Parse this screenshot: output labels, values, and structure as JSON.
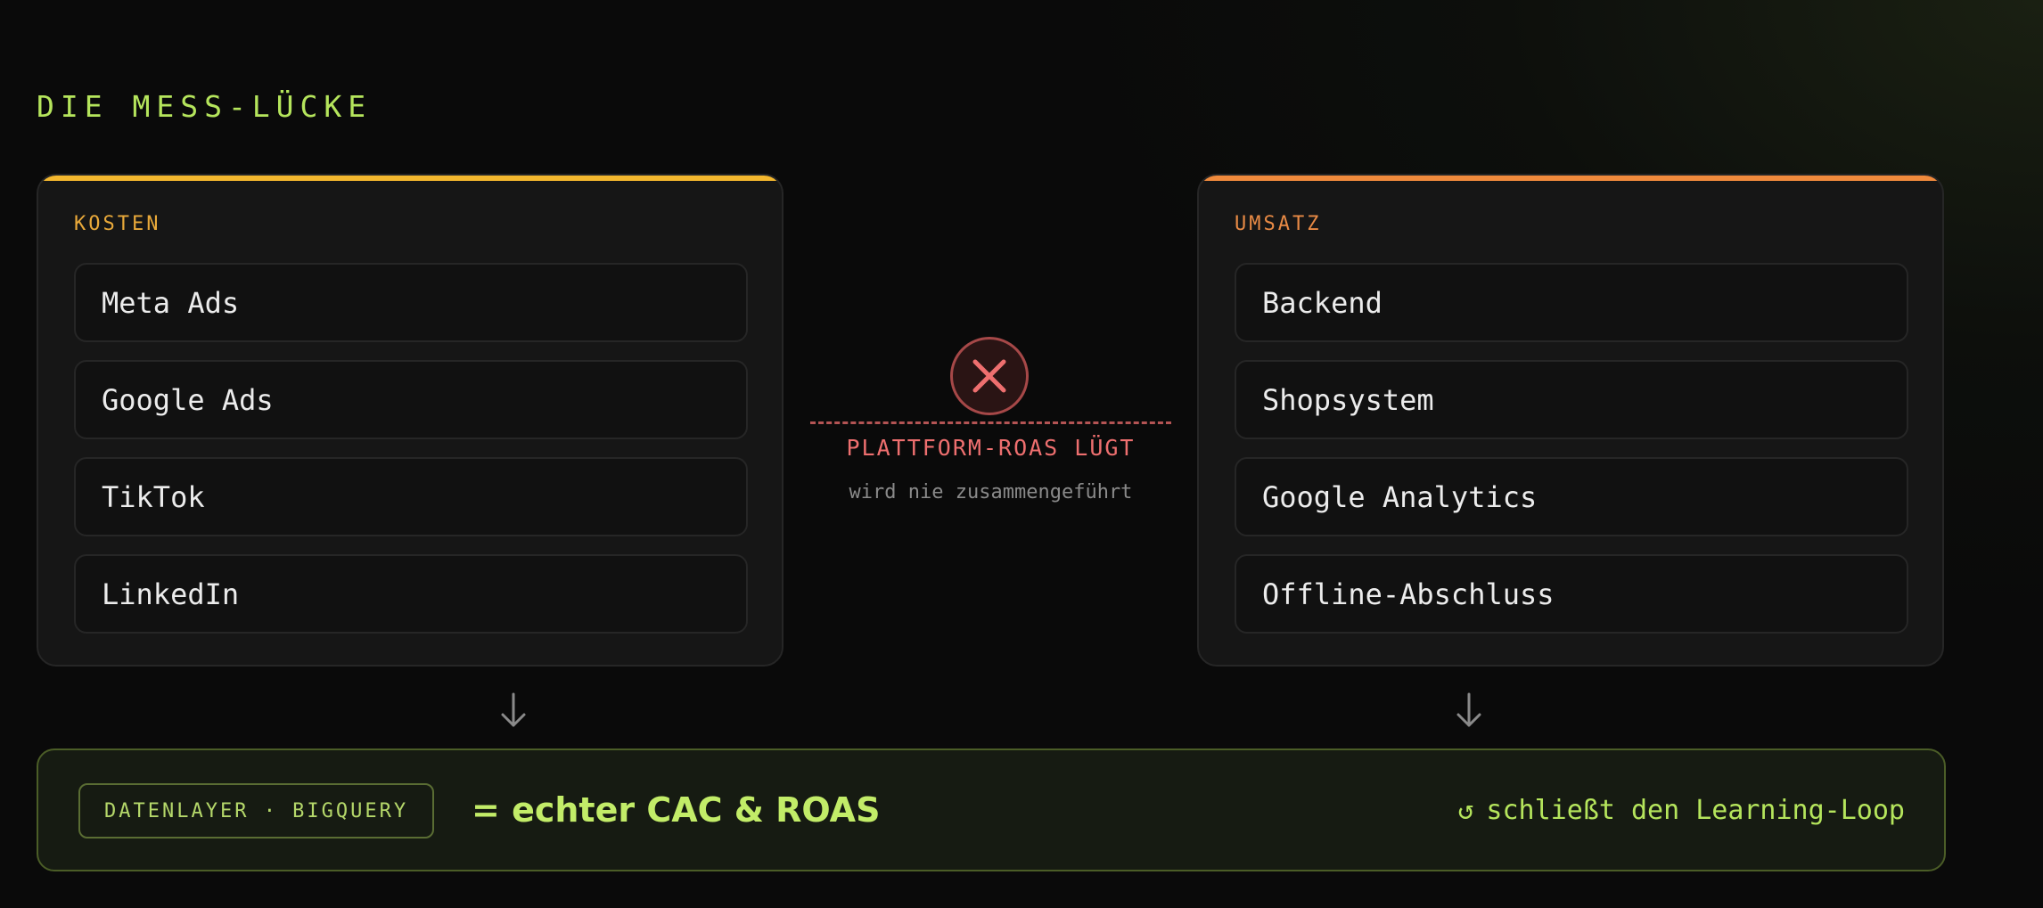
{
  "section_title": "DIE MESS-LÜCKE",
  "cost_panel": {
    "label": "KOSTEN",
    "items": [
      "Meta Ads",
      "Google Ads",
      "TikTok",
      "LinkedIn"
    ]
  },
  "revenue_panel": {
    "label": "UMSATZ",
    "items": [
      "Backend",
      "Shopsystem",
      "Google Analytics",
      "Offline-Abschluss"
    ]
  },
  "gap": {
    "icon": "close-x-icon",
    "title": "PLATTFORM-ROAS LÜGT",
    "subtitle": "wird nie zusammengeführt"
  },
  "result": {
    "tag": "DATENLAYER · BIGQUERY",
    "headline": "= echter CAC & ROAS",
    "loop_icon": "↺",
    "loop_text": "schließt den Learning-Loop"
  },
  "colors": {
    "accent_green": "#b5e55c",
    "cost_accent": "#f3b72e",
    "revenue_accent": "#f08a3c",
    "error_red": "#ee6f6f"
  }
}
